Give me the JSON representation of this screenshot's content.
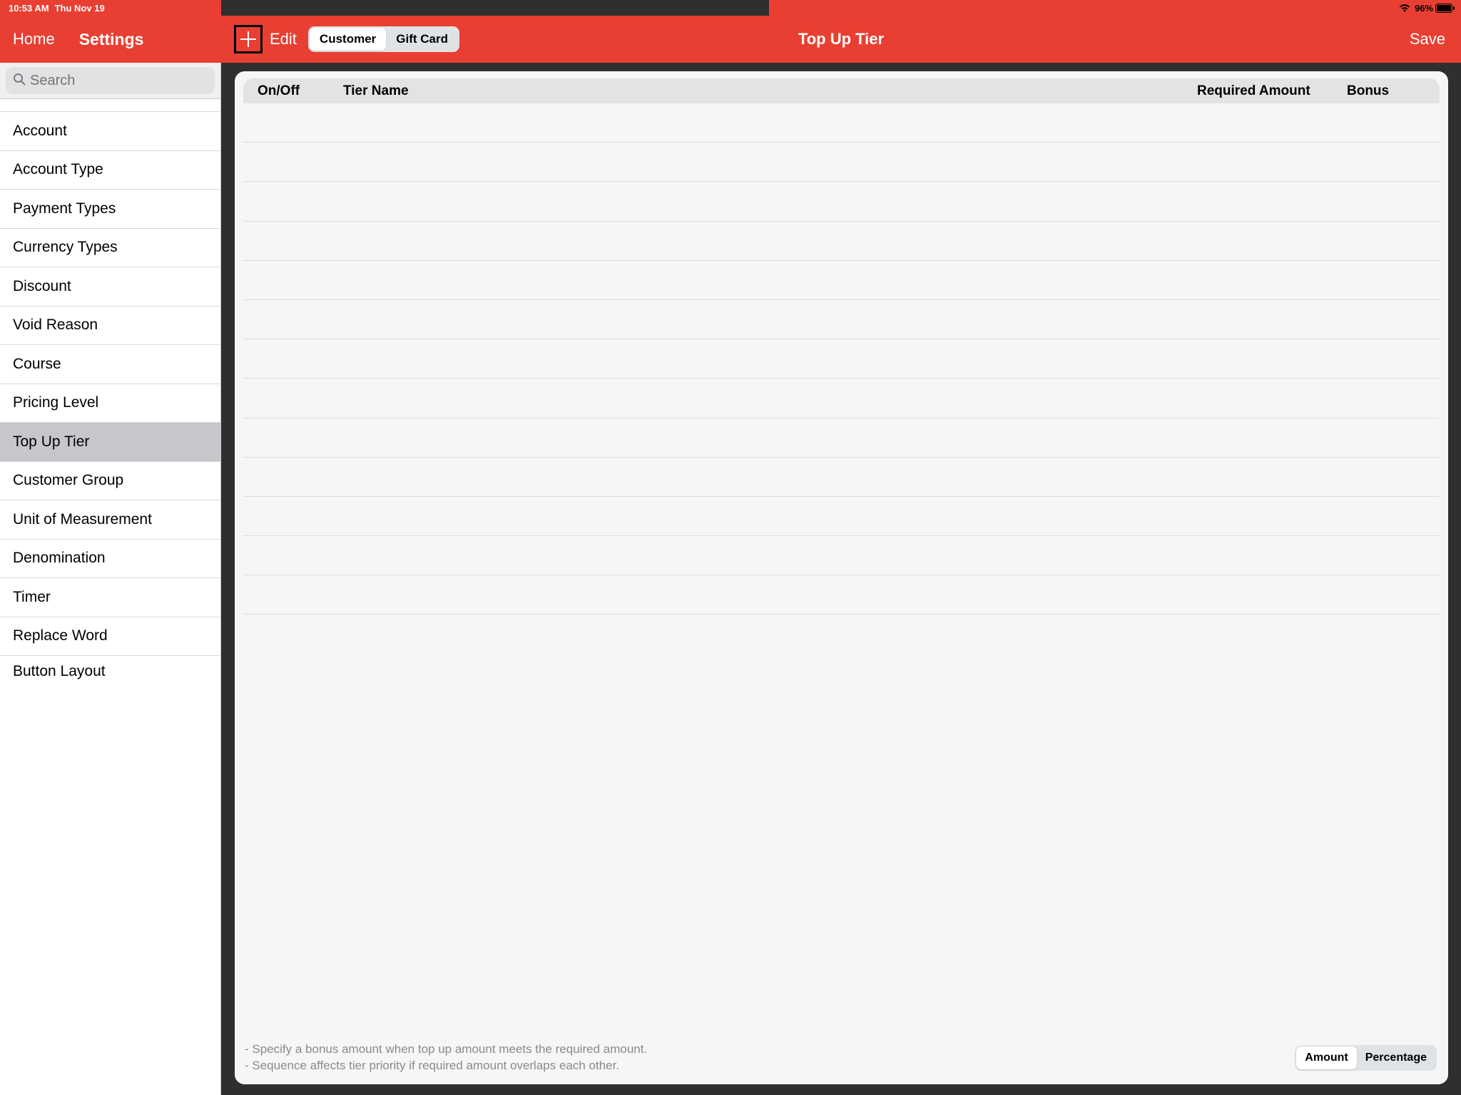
{
  "status": {
    "time": "10:53 AM",
    "date": "Thu Nov 19",
    "battery": "96%"
  },
  "leftHeader": {
    "home": "Home",
    "settings": "Settings"
  },
  "rightHeader": {
    "edit": "Edit",
    "segment": {
      "customer": "Customer",
      "giftcard": "Gift Card",
      "active": "customer"
    },
    "title": "Top Up Tier",
    "save": "Save"
  },
  "search": {
    "placeholder": "Search"
  },
  "sidebar": {
    "items": [
      "Account",
      "Account Type",
      "Payment Types",
      "Currency Types",
      "Discount",
      "Void Reason",
      "Course",
      "Pricing Level",
      "Top Up Tier",
      "Customer Group",
      "Unit of Measurement",
      "Denomination",
      "Timer",
      "Replace Word",
      "Button Layout"
    ],
    "selected": "Top Up Tier"
  },
  "table": {
    "headers": {
      "onoff": "On/Off",
      "name": "Tier Name",
      "required": "Required Amount",
      "bonus": "Bonus"
    }
  },
  "footer": {
    "note1": "- Specify a bonus amount when top up amount meets the required amount.",
    "note2": "- Sequence affects tier priority if required amount overlaps each other.",
    "segment": {
      "amount": "Amount",
      "percentage": "Percentage",
      "active": "amount"
    }
  }
}
